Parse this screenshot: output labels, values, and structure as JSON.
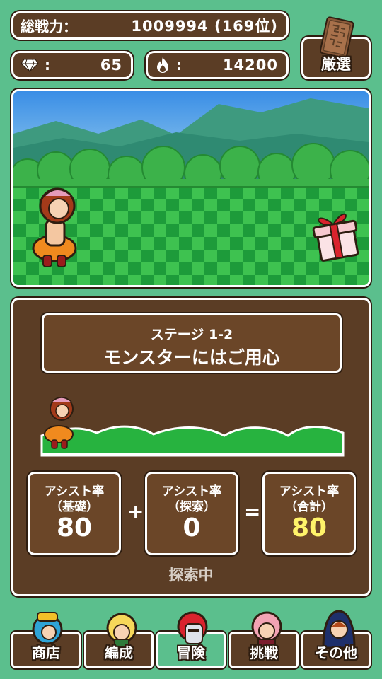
{
  "header": {
    "total_power_label": "総戦力：",
    "total_power_value": "1009994 (169位)",
    "gems_label": ":",
    "gems_value": "65",
    "fire_label": ":",
    "fire_value": "14200",
    "book_button_label": "厳選"
  },
  "panel": {
    "stage_number": "ステージ 1-2",
    "stage_title": "モンスターにはご用心",
    "assist_base": {
      "line1": "アシスト率",
      "line2": "（基礎）",
      "value": "80"
    },
    "assist_explore": {
      "line1": "アシスト率",
      "line2": "（探索）",
      "value": "0"
    },
    "assist_total": {
      "line1": "アシスト率",
      "line2": "（合計）",
      "value": "80"
    },
    "plus": "+",
    "equals": "=",
    "status": "探索中"
  },
  "nav": {
    "shop": "商店",
    "formation": "編成",
    "adventure": "冒険",
    "challenge": "挑戦",
    "other": "その他"
  },
  "colors": {
    "background": "#5bbf8d",
    "panel_brown": "#5b3d25",
    "total_yellow": "#fff36a"
  }
}
